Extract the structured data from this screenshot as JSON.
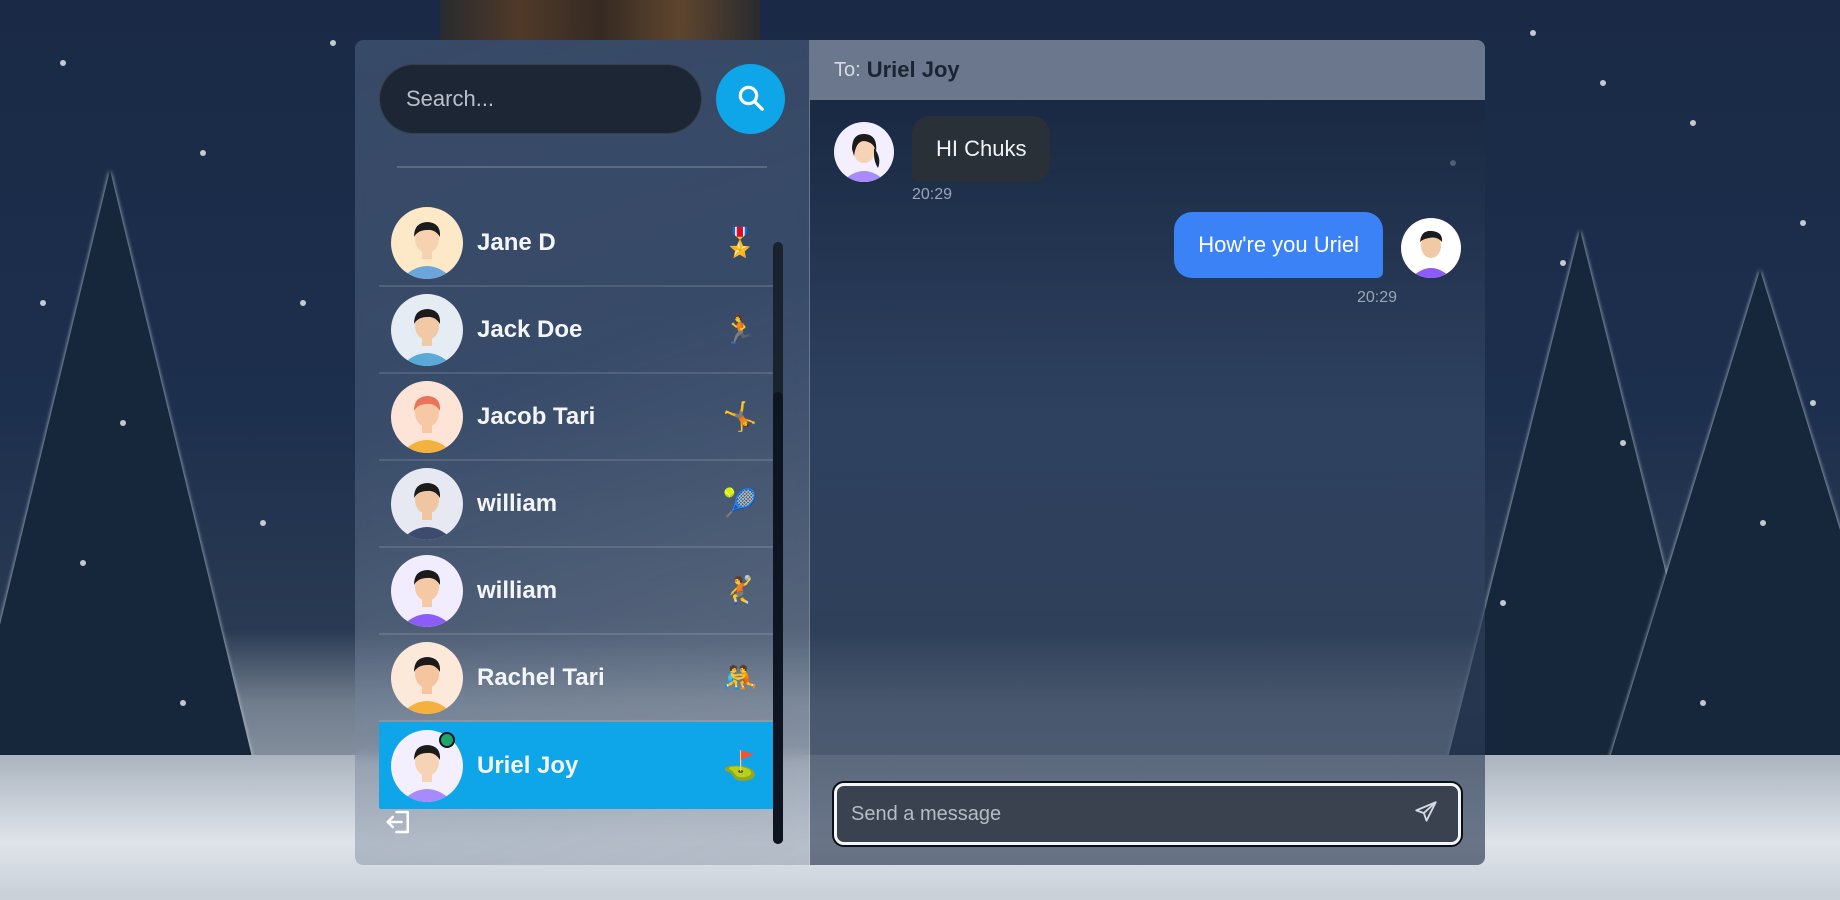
{
  "search": {
    "placeholder": "Search..."
  },
  "contacts": [
    {
      "name": "Jane D",
      "badge": "🎖️",
      "avatar_skin": "#f7d2b0",
      "avatar_shirt": "#6aa6d9",
      "avatar_bg": "#fde8c8",
      "avatar_hair": "#1b1b1b",
      "online": false,
      "active": false
    },
    {
      "name": "Jack Doe",
      "badge": "🏃",
      "avatar_skin": "#f1c9a5",
      "avatar_shirt": "#5aa9d6",
      "avatar_bg": "#e6ecf4",
      "avatar_hair": "#1b1b1b",
      "online": false,
      "active": false
    },
    {
      "name": "Jacob Tari",
      "badge": "🤸",
      "avatar_skin": "#f6c8a6",
      "avatar_shirt": "#f5b13d",
      "avatar_bg": "#fde4d6",
      "avatar_hair": "#e8745a",
      "online": false,
      "active": false
    },
    {
      "name": "william",
      "badge": "🎾",
      "avatar_skin": "#f0c6a2",
      "avatar_shirt": "#3e4a6e",
      "avatar_bg": "#e6e8f2",
      "avatar_hair": "#1b1b1b",
      "online": false,
      "active": false
    },
    {
      "name": "william",
      "badge": "🤾",
      "avatar_skin": "#f5c9a3",
      "avatar_shirt": "#8b5cf6",
      "avatar_bg": "#f2ecff",
      "avatar_hair": "#1b1b1b",
      "online": false,
      "active": false
    },
    {
      "name": "Rachel Tari",
      "badge": "🤼",
      "avatar_skin": "#f6c49e",
      "avatar_shirt": "#f5b13d",
      "avatar_bg": "#fde9d9",
      "avatar_hair": "#1b1b1b",
      "online": false,
      "active": false
    },
    {
      "name": "Uriel Joy",
      "badge": "⛳",
      "avatar_skin": "#f6d3b5",
      "avatar_shirt": "#a78bfa",
      "avatar_bg": "#f4efff",
      "avatar_hair": "#1b1b1b",
      "online": true,
      "active": true
    }
  ],
  "chat": {
    "to_label": "To:",
    "to_name": "Uriel Joy",
    "messages": [
      {
        "direction": "in",
        "text": "HI Chuks",
        "time": "20:29"
      },
      {
        "direction": "out",
        "text": "How're you Uriel",
        "time": "20:29"
      }
    ],
    "composer_placeholder": "Send a message"
  },
  "colors": {
    "accent": "#0ea5e9",
    "outgoing_bubble": "#3b82f6",
    "incoming_bubble": "#2a3038",
    "header": "#6b778c",
    "online": "#1fa565"
  },
  "icons": {
    "search": "magnifier-icon",
    "logout": "logout-icon",
    "send": "paper-plane-icon"
  }
}
